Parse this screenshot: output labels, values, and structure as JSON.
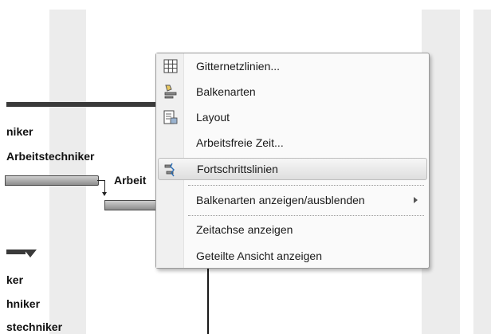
{
  "gantt": {
    "labels": [
      "niker",
      "Arbeitstechniker",
      "Arbeit",
      "ker",
      "hniker",
      "stechniker"
    ]
  },
  "context_menu": {
    "items": [
      {
        "label": "Gitternetzlinien...",
        "icon": "gridlines-icon"
      },
      {
        "label": "Balkenarten",
        "icon": "bar-styles-icon"
      },
      {
        "label": "Layout",
        "icon": "layout-icon"
      },
      {
        "label": "Arbeitsfreie Zeit..."
      },
      {
        "label": "Fortschrittslinien",
        "icon": "progress-lines-icon",
        "hovered": true
      },
      {
        "label": "Balkenarten anzeigen/ausblenden",
        "submenu": true
      },
      {
        "label": "Zeitachse anzeigen"
      },
      {
        "label": "Geteilte Ansicht anzeigen"
      }
    ]
  }
}
